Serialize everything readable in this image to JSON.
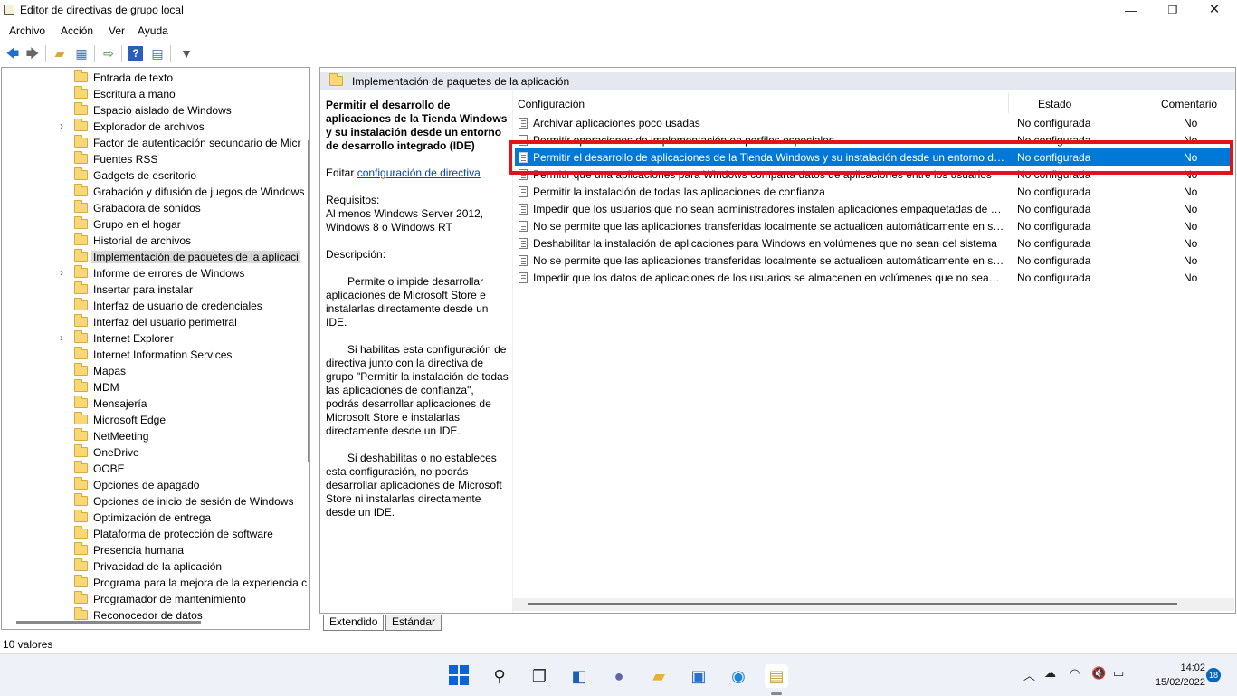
{
  "window": {
    "title": "Editor de directivas de grupo local",
    "min_glyph": "—",
    "max_glyph": "❐",
    "close_glyph": "✕"
  },
  "menu": [
    "Archivo",
    "Acción",
    "Ver",
    "Ayuda"
  ],
  "tree": {
    "items": [
      {
        "label": "Entrada de texto",
        "expandable": false
      },
      {
        "label": "Escritura a mano",
        "expandable": false
      },
      {
        "label": "Espacio aislado de Windows",
        "expandable": false
      },
      {
        "label": "Explorador de archivos",
        "expandable": true
      },
      {
        "label": "Factor de autenticación secundario de Micr",
        "expandable": false
      },
      {
        "label": "Fuentes RSS",
        "expandable": false
      },
      {
        "label": "Gadgets de escritorio",
        "expandable": false
      },
      {
        "label": "Grabación y difusión de juegos de Windows",
        "expandable": false
      },
      {
        "label": "Grabadora de sonidos",
        "expandable": false
      },
      {
        "label": "Grupo en el hogar",
        "expandable": false
      },
      {
        "label": "Historial de archivos",
        "expandable": false
      },
      {
        "label": "Implementación de paquetes de la aplicaci",
        "expandable": false,
        "selected": true
      },
      {
        "label": "Informe de errores de Windows",
        "expandable": true
      },
      {
        "label": "Insertar para instalar",
        "expandable": false
      },
      {
        "label": "Interfaz de usuario de credenciales",
        "expandable": false
      },
      {
        "label": "Interfaz del usuario perimetral",
        "expandable": false
      },
      {
        "label": "Internet Explorer",
        "expandable": true
      },
      {
        "label": "Internet Information Services",
        "expandable": false
      },
      {
        "label": "Mapas",
        "expandable": false
      },
      {
        "label": "MDM",
        "expandable": false
      },
      {
        "label": "Mensajería",
        "expandable": false
      },
      {
        "label": "Microsoft Edge",
        "expandable": false
      },
      {
        "label": "NetMeeting",
        "expandable": false
      },
      {
        "label": "OneDrive",
        "expandable": false
      },
      {
        "label": "OOBE",
        "expandable": false
      },
      {
        "label": "Opciones de apagado",
        "expandable": false
      },
      {
        "label": "Opciones de inicio de sesión de Windows",
        "expandable": false
      },
      {
        "label": "Optimización de entrega",
        "expandable": false
      },
      {
        "label": "Plataforma de protección de software",
        "expandable": false
      },
      {
        "label": "Presencia humana",
        "expandable": false
      },
      {
        "label": "Privacidad de la aplicación",
        "expandable": false
      },
      {
        "label": "Programa para la mejora de la experiencia c",
        "expandable": false
      },
      {
        "label": "Programador de mantenimiento",
        "expandable": false
      },
      {
        "label": "Reconocedor de datos",
        "expandable": false
      }
    ]
  },
  "right": {
    "header": "Implementación de paquetes de la aplicación",
    "description": {
      "title": "Permitir el desarrollo de aplicaciones de la Tienda Windows y su instalación desde un entorno de desarrollo integrado (IDE)",
      "edit_prefix": "Editar ",
      "edit_link": "configuración de directiva",
      "requirements_label": "Requisitos:",
      "requirements": "Al menos Windows Server 2012, Windows 8 o Windows RT",
      "description_label": "Descripción:",
      "p1": "Permite o impide desarrollar aplicaciones de Microsoft Store e instalarlas directamente desde un IDE.",
      "p2": "Si habilitas esta configuración de directiva junto con la directiva de grupo \"Permitir la instalación de todas las aplicaciones de confianza\", podrás desarrollar aplicaciones de Microsoft Store e instalarlas directamente desde un IDE.",
      "p3": "Si deshabilitas o no estableces esta configuración, no podrás desarrollar aplicaciones de Microsoft Store ni instalarlas directamente desde un IDE."
    },
    "columns": {
      "setting": "Configuración",
      "state": "Estado",
      "comment": "Comentario"
    },
    "rows": [
      {
        "name": "Archivar aplicaciones poco usadas",
        "state": "No configurada",
        "comment": "No"
      },
      {
        "name": "Permitir operaciones de implementación en perfiles especiales",
        "state": "No configurada",
        "comment": "No"
      },
      {
        "name": "Permitir el desarrollo de aplicaciones de la Tienda Windows y su instalación desde un entorno de desarrollo integrado (IDE)",
        "state": "No configurada",
        "comment": "No",
        "selected": true
      },
      {
        "name": "Permitir que una aplicaciones para Windows comparta datos de aplicaciones entre los usuarios",
        "state": "No configurada",
        "comment": "No"
      },
      {
        "name": "Permitir la instalación de todas las aplicaciones de confianza",
        "state": "No configurada",
        "comment": "No"
      },
      {
        "name": "Impedir que los usuarios que no sean administradores instalen aplicaciones empaquetadas de Windows",
        "state": "No configurada",
        "comment": "No"
      },
      {
        "name": "No se permite que las aplicaciones transferidas localmente se actualicen automáticamente en segundo plano",
        "state": "No configurada",
        "comment": "No"
      },
      {
        "name": "Deshabilitar la instalación de aplicaciones para Windows en volúmenes que no sean del sistema",
        "state": "No configurada",
        "comment": "No"
      },
      {
        "name": "No se permite que las aplicaciones transferidas localmente se actualicen automáticamente en segundo plano",
        "state": "No configurada",
        "comment": "No"
      },
      {
        "name": "Impedir que los datos de aplicaciones de los usuarios se almacenen en volúmenes que no sean del sistema",
        "state": "No configurada",
        "comment": "No"
      }
    ]
  },
  "tabs": {
    "extended": "Extendido",
    "standard": "Estándar"
  },
  "status": {
    "text": "10 valores"
  },
  "taskbar": {
    "time": "14:02",
    "date": "15/02/2022",
    "notifications": "18",
    "icons": [
      "start-icon",
      "search-icon",
      "task-view-icon",
      "widgets-icon",
      "chat-icon",
      "file-explorer-icon",
      "store-icon",
      "edge-icon",
      "gpedit-icon"
    ]
  },
  "colors": {
    "selection": "#0078d7",
    "highlight_border": "#e3131d",
    "header_band": "#e5e8ef"
  }
}
